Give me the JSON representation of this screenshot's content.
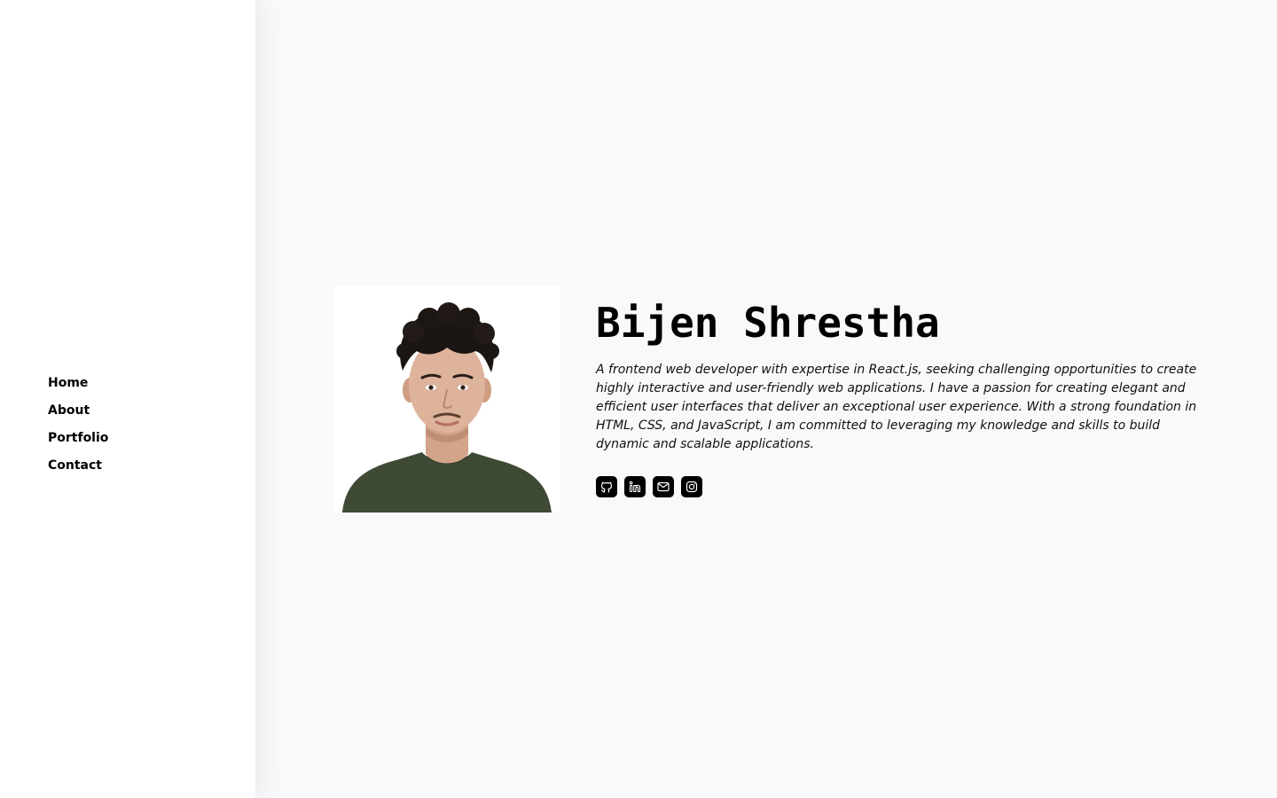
{
  "nav": {
    "items": [
      {
        "label": "Home"
      },
      {
        "label": "About"
      },
      {
        "label": "Portfolio"
      },
      {
        "label": "Contact"
      }
    ]
  },
  "profile": {
    "name": "Bijen Shrestha",
    "bio": "A frontend web developer with expertise in React.js, seeking challenging opportunities to create highly interactive and user-friendly web applications. I have a passion for creating elegant and efficient user interfaces that deliver an exceptional user experience. With a strong foundation in HTML, CSS, and JavaScript, I am committed to leveraging my knowledge and skills to build dynamic and scalable applications."
  },
  "social_links": [
    {
      "icon": "github-icon"
    },
    {
      "icon": "linkedin-icon"
    },
    {
      "icon": "mail-icon"
    },
    {
      "icon": "instagram-icon"
    }
  ],
  "colors": {
    "background": "#f8f9fb",
    "sidebar": "#ffffff",
    "text": "#000000",
    "icon_tile": "#000000",
    "shirt": "#3f4a34"
  }
}
